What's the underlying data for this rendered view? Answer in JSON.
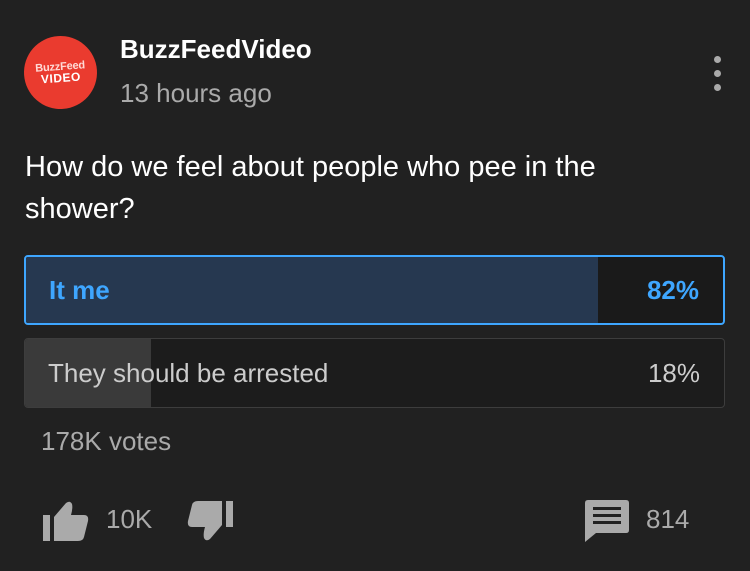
{
  "post": {
    "avatar_line1": "BuzzFeed",
    "avatar_line2": "VIDEO",
    "channel_name": "BuzzFeedVideo",
    "time_ago": "13 hours ago",
    "question": "How do we feel about people who pee in the shower?"
  },
  "poll": {
    "options": [
      {
        "label": "It me",
        "percent_text": "82%",
        "percent": 82,
        "selected": true
      },
      {
        "label": "They should be arrested",
        "percent_text": "18%",
        "percent": 18,
        "selected": false
      }
    ],
    "votes": "178K votes"
  },
  "actions": {
    "like_count": "10K",
    "comment_count": "814"
  },
  "icons": [
    "more-vert-icon",
    "thumbs-up-icon",
    "thumbs-down-icon",
    "comment-icon"
  ],
  "colors": {
    "background": "#212121",
    "accent": "#3ea6ff",
    "selected_fill": "#263850",
    "avatar_red": "#ea3b2f",
    "secondary_text": "#aaaaaa"
  }
}
